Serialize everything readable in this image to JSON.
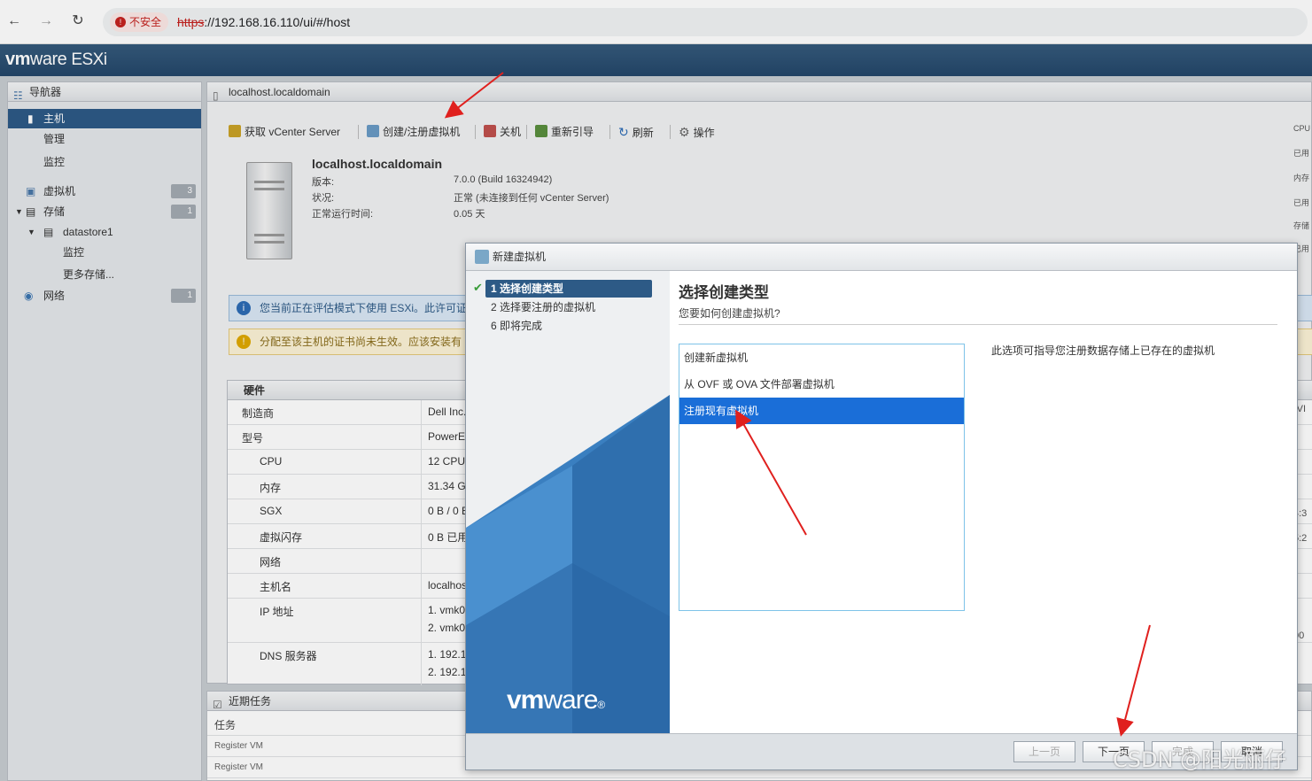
{
  "browser": {
    "security_label": "不安全",
    "url_scheme": "https",
    "url_rest": "://192.168.16.110/ui/#/host"
  },
  "header": {
    "logo_vm": "vm",
    "logo_rest": "ware",
    "logo_product": "ESXi"
  },
  "navigator": {
    "title": "导航器",
    "items": [
      {
        "label": "主机",
        "badge": ""
      },
      {
        "label": "管理",
        "badge": ""
      },
      {
        "label": "监控",
        "badge": ""
      },
      {
        "label": "虚拟机",
        "badge": "3"
      },
      {
        "label": "存储",
        "badge": "1"
      },
      {
        "label": "datastore1",
        "badge": ""
      },
      {
        "label": "监控",
        "badge": ""
      },
      {
        "label": "更多存储...",
        "badge": ""
      },
      {
        "label": "网络",
        "badge": "1"
      }
    ]
  },
  "host": {
    "panel_title": "localhost.localdomain",
    "toolbar": [
      "获取 vCenter Server",
      "创建/注册虚拟机",
      "关机",
      "重新引导",
      "刷新",
      "操作"
    ],
    "name": "localhost.localdomain",
    "details": [
      {
        "k": "版本:",
        "v": "7.0.0 (Build 16324942)"
      },
      {
        "k": "状况:",
        "v": "正常 (未连接到任何 vCenter Server)"
      },
      {
        "k": "正常运行时间:",
        "v": "0.05 天"
      }
    ],
    "info_msg": "您当前正在评估模式下使用 ESXi。此许可证",
    "warn_msg": "分配至该主机的证书尚未生效。应该安装有",
    "hardware": {
      "title": "硬件",
      "rows": [
        {
          "k": "制造商",
          "v": "Dell Inc."
        },
        {
          "k": "型号",
          "v": "PowerE"
        },
        {
          "k": "CPU",
          "v": "12 CPU"
        },
        {
          "k": "内存",
          "v": "31.34 G"
        },
        {
          "k": "SGX",
          "v": "0 B / 0 B"
        },
        {
          "k": "虚拟闪存",
          "v": "0 B 已用"
        },
        {
          "k": "网络",
          "v": ""
        },
        {
          "k": "主机名",
          "v": "localhos"
        },
        {
          "k": "IP 地址",
          "v": "1. vmk0:",
          "v2": "2. vmk0:"
        },
        {
          "k": "DNS 服务器",
          "v": "1. 192.1",
          "v2": "2. 192.1"
        }
      ]
    }
  },
  "tasks": {
    "title": "近期任务",
    "col_task": "任务",
    "rows": [
      "Register VM",
      "Register VM"
    ]
  },
  "right_strip": [
    "CPU",
    "已用",
    "内存",
    "已用",
    "存储",
    "已用",
    "(VI",
    "4:3",
    "5:2",
    "00"
  ],
  "wizard": {
    "title": "新建虚拟机",
    "steps": [
      "1 选择创建类型",
      "2 选择要注册的虚拟机",
      "6 即将完成"
    ],
    "logo_vm": "vm",
    "logo_rest": "ware",
    "heading": "选择创建类型",
    "subheading": "您要如何创建虚拟机?",
    "options": [
      "创建新虚拟机",
      "从 OVF 或 OVA 文件部署虚拟机",
      "注册现有虚拟机"
    ],
    "description": "此选项可指导您注册数据存储上已存在的虚拟机",
    "buttons": {
      "back": "上一页",
      "next": "下一页",
      "finish": "完成",
      "cancel": "取消"
    }
  },
  "watermark": "CSDN @阳光丽仔",
  "colors": {
    "esxi_header": "#2b4e72",
    "selection": "#1a6ed8",
    "arrow": "#e0201e"
  }
}
